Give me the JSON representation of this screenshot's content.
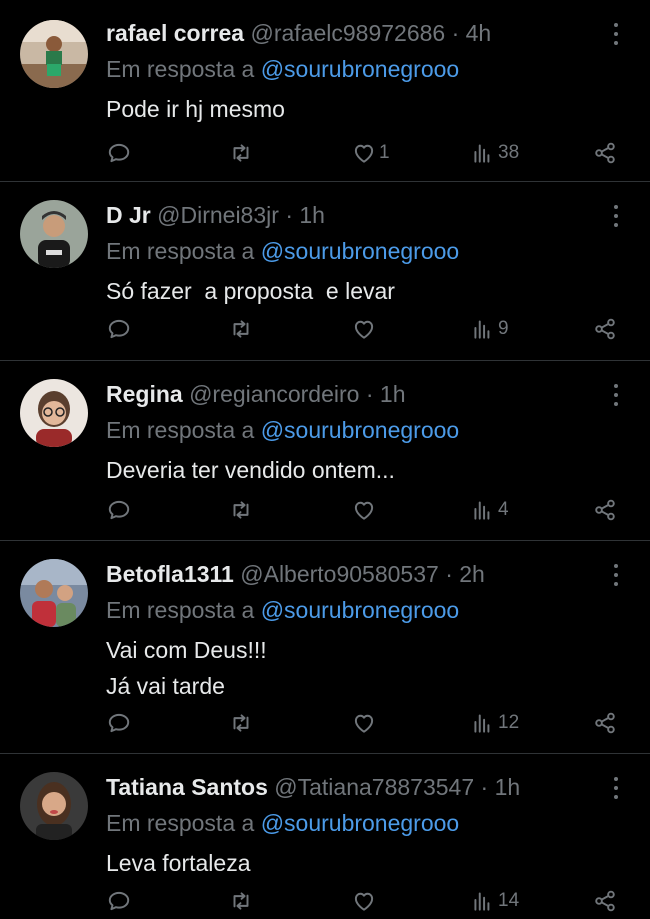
{
  "labels": {
    "reply_prefix": "Em resposta a"
  },
  "colors": {
    "background": "#000000",
    "primary_text": "#e7e9ea",
    "secondary_text": "#71767b",
    "mention": "#4c9be8",
    "divider": "#2f3336"
  },
  "tweets": [
    {
      "name": "rafael correa",
      "handle": "@rafaelc98972686",
      "time": "· 4h",
      "reply_to": "@sourubronegrooo",
      "lines": [
        "Pode ir hj mesmo"
      ],
      "likes": "1",
      "views": "38"
    },
    {
      "name": "D Jr",
      "handle": "@Dirnei83jr",
      "time": "· 1h",
      "reply_to": "@sourubronegrooo",
      "lines": [
        "Só fazer  a proposta  e levar"
      ],
      "likes": "",
      "views": "9"
    },
    {
      "name": "Regina",
      "handle": "@regiancordeiro",
      "time": "· 1h",
      "reply_to": "@sourubronegrooo",
      "lines": [
        "Deveria ter vendido ontem..."
      ],
      "likes": "",
      "views": "4"
    },
    {
      "name": "Betofla1311",
      "handle": "@Alberto90580537",
      "time": "· 2h",
      "reply_to": "@sourubronegrooo",
      "lines": [
        "Vai com Deus!!!",
        "Já vai tarde"
      ],
      "likes": "",
      "views": "12"
    },
    {
      "name": "Tatiana Santos",
      "handle": "@Tatiana78873547",
      "time": "· 1h",
      "reply_to": "@sourubronegrooo",
      "lines": [
        "Leva fortaleza"
      ],
      "likes": "",
      "views": "14"
    }
  ]
}
